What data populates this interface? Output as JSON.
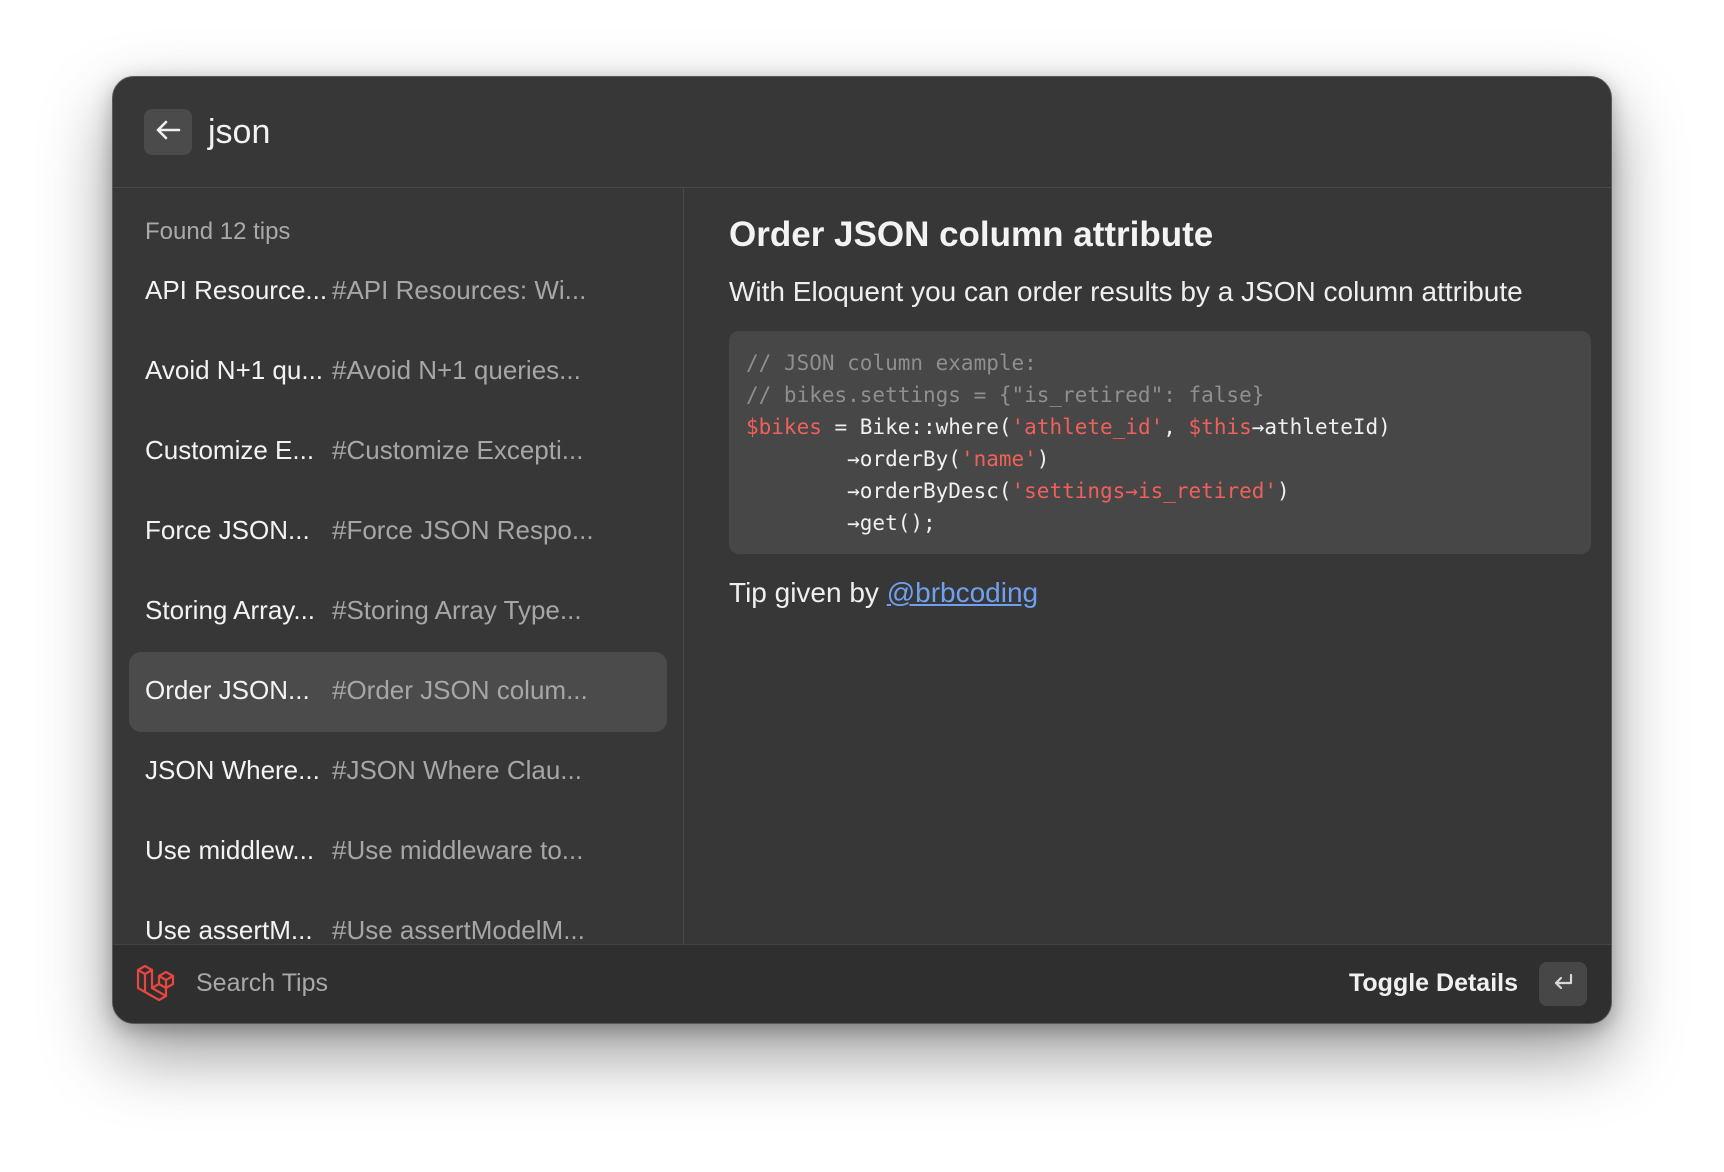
{
  "header": {
    "search_value": "json"
  },
  "results": {
    "count_label": "Found 12 tips",
    "items": [
      {
        "title": "API Resource...",
        "tag": "#API Resources: Wi..."
      },
      {
        "title": "Avoid N+1 qu...",
        "tag": "#Avoid N+1 queries..."
      },
      {
        "title": "Customize E...",
        "tag": "#Customize Excepti..."
      },
      {
        "title": "Force JSON...",
        "tag": "#Force JSON Respo..."
      },
      {
        "title": "Storing Array...",
        "tag": "#Storing Array Type..."
      },
      {
        "title": "Order JSON...",
        "tag": "#Order JSON colum...",
        "selected": true
      },
      {
        "title": "JSON Where...",
        "tag": "#JSON Where Clau..."
      },
      {
        "title": "Use middlew...",
        "tag": "#Use middleware to..."
      },
      {
        "title": "Use assertM...",
        "tag": "#Use assertModelM..."
      }
    ]
  },
  "detail": {
    "title": "Order JSON column attribute",
    "description": "With Eloquent you can order results by a JSON column attribute",
    "code": {
      "comment1": "// JSON column example:",
      "comment2": "// bikes.settings = {\"is_retired\": false}",
      "l3_var": "$bikes",
      "l3_a": " = Bike::where(",
      "l3_str": "'athlete_id'",
      "l3_b": ", ",
      "l3_var2": "$this",
      "l3_c": "→athleteId)",
      "l4_a": "        →orderBy(",
      "l4_str": "'name'",
      "l4_b": ")",
      "l5_a": "        →orderByDesc(",
      "l5_str": "'settings→is_retired'",
      "l5_b": ")",
      "l6": "        →get();"
    },
    "tip_prefix": "Tip given by ",
    "tip_author": "@brbcoding"
  },
  "footer": {
    "label": "Search Tips",
    "action_label": "Toggle Details"
  },
  "colors": {
    "background": "#373737",
    "footer": "#2f2f2f",
    "selected_row": "#4b4b4b",
    "code_bg": "#474747",
    "code_red": "#f0605a",
    "link": "#6fa0f0",
    "logo_red": "#e8473f"
  },
  "icons": {
    "back": "arrow-left-icon",
    "logo": "laravel-logo-icon",
    "enter": "return-key-icon"
  }
}
